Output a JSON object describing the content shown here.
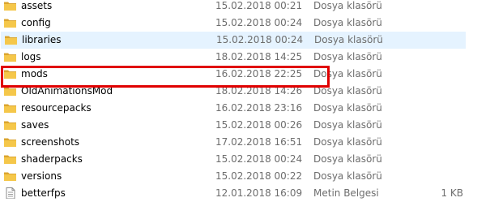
{
  "colors": {
    "folder": "#f5c74a",
    "folder_dark": "#dba42e",
    "selected_row_bg": "#e5f3ff",
    "annotation_box": "#e00000",
    "secondary_text": "#6d6d6d"
  },
  "rows": [
    {
      "name": "assets",
      "date": "15.02.2018 00:21",
      "type": "Dosya klasörü",
      "size": "",
      "icon": "folder-icon"
    },
    {
      "name": "config",
      "date": "15.02.2018 00:24",
      "type": "Dosya klasörü",
      "size": "",
      "icon": "folder-icon"
    },
    {
      "name": "libraries",
      "date": "15.02.2018 00:24",
      "type": "Dosya klasörü",
      "size": "",
      "icon": "folder-icon",
      "selected": true
    },
    {
      "name": "logs",
      "date": "18.02.2018 14:25",
      "type": "Dosya klasörü",
      "size": "",
      "icon": "folder-icon"
    },
    {
      "name": "mods",
      "date": "16.02.2018 22:25",
      "type": "Dosya klasörü",
      "size": "",
      "icon": "folder-icon",
      "annotated": true
    },
    {
      "name": "OldAnimationsMod",
      "date": "18.02.2018 14:26",
      "type": "Dosya klasörü",
      "size": "",
      "icon": "folder-icon"
    },
    {
      "name": "resourcepacks",
      "date": "16.02.2018 23:16",
      "type": "Dosya klasörü",
      "size": "",
      "icon": "folder-icon"
    },
    {
      "name": "saves",
      "date": "15.02.2018 00:26",
      "type": "Dosya klasörü",
      "size": "",
      "icon": "folder-icon"
    },
    {
      "name": "screenshots",
      "date": "17.02.2018 16:51",
      "type": "Dosya klasörü",
      "size": "",
      "icon": "folder-icon"
    },
    {
      "name": "shaderpacks",
      "date": "15.02.2018 00:24",
      "type": "Dosya klasörü",
      "size": "",
      "icon": "folder-icon"
    },
    {
      "name": "versions",
      "date": "15.02.2018 00:22",
      "type": "Dosya klasörü",
      "size": "",
      "icon": "folder-icon"
    },
    {
      "name": "betterfps",
      "date": "12.01.2018 16:09",
      "type": "Metin Belgesi",
      "size": "1 KB",
      "icon": "text-file-icon"
    }
  ]
}
